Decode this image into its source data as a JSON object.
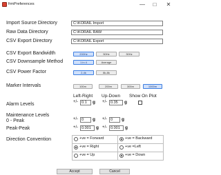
{
  "window": {
    "title": "frmPreferences",
    "min_glyph": "—",
    "max_glyph": "□",
    "close_glyph": "✕"
  },
  "directories": {
    "import_label": "Import Source Directory",
    "import_value": "C:\\KORAIL Import",
    "raw_label": "Raw Data Directory",
    "raw_value": "C:\\KORAIL RAW",
    "csv_label": "CSV Export Directory",
    "csv_value": "C:\\KORAIL Export"
  },
  "bandwidth": {
    "label": "CSV Export Bandwidth",
    "options": [
      "200Hz",
      "50Hz",
      "30Hz"
    ],
    "selected": "200Hz"
  },
  "downsample": {
    "label": "CSV Downsample Method",
    "options": [
      "1 in 4",
      "Average"
    ],
    "selected": "1 in 4"
  },
  "power_factor": {
    "label": "CSV Power Factor",
    "options": [
      "2-4k",
      "8k-8k"
    ],
    "selected": "2-4k"
  },
  "marker": {
    "label": "Marker Intervals",
    "options": [
      "100m",
      "200m",
      "300m",
      "1000m"
    ],
    "selected": "1000m"
  },
  "levels": {
    "col_left_right": "Left-Right",
    "col_up_down": "Up-Down",
    "col_show_on_plot": "Show On Plot",
    "alarm_label": "Alarm Levels",
    "alarm_lr_value": "0.1",
    "alarm_ud_value": "0.35",
    "maint_label_1": "Maintenance Levels",
    "maint_label_2": "0 - Peak",
    "maint_lr_value": "0",
    "maint_ud_value": "0",
    "peak_label": "Peak-Peak",
    "peak_lr_value": "0.001",
    "peak_ud_value": "0.001",
    "pm": "+/-",
    "unit": "g"
  },
  "direction": {
    "label": "Direction Convention",
    "rows": [
      {
        "left": "+ve = Forward",
        "right": "+ve = Backward",
        "selected": "right"
      },
      {
        "left": "+ve = Right",
        "right": "+ve =Left",
        "selected": "left"
      },
      {
        "left": "+ve = Up",
        "right": "+ve = Down",
        "selected": "right"
      }
    ]
  },
  "footer": {
    "accept": "Accept",
    "cancel": "Cancel"
  }
}
